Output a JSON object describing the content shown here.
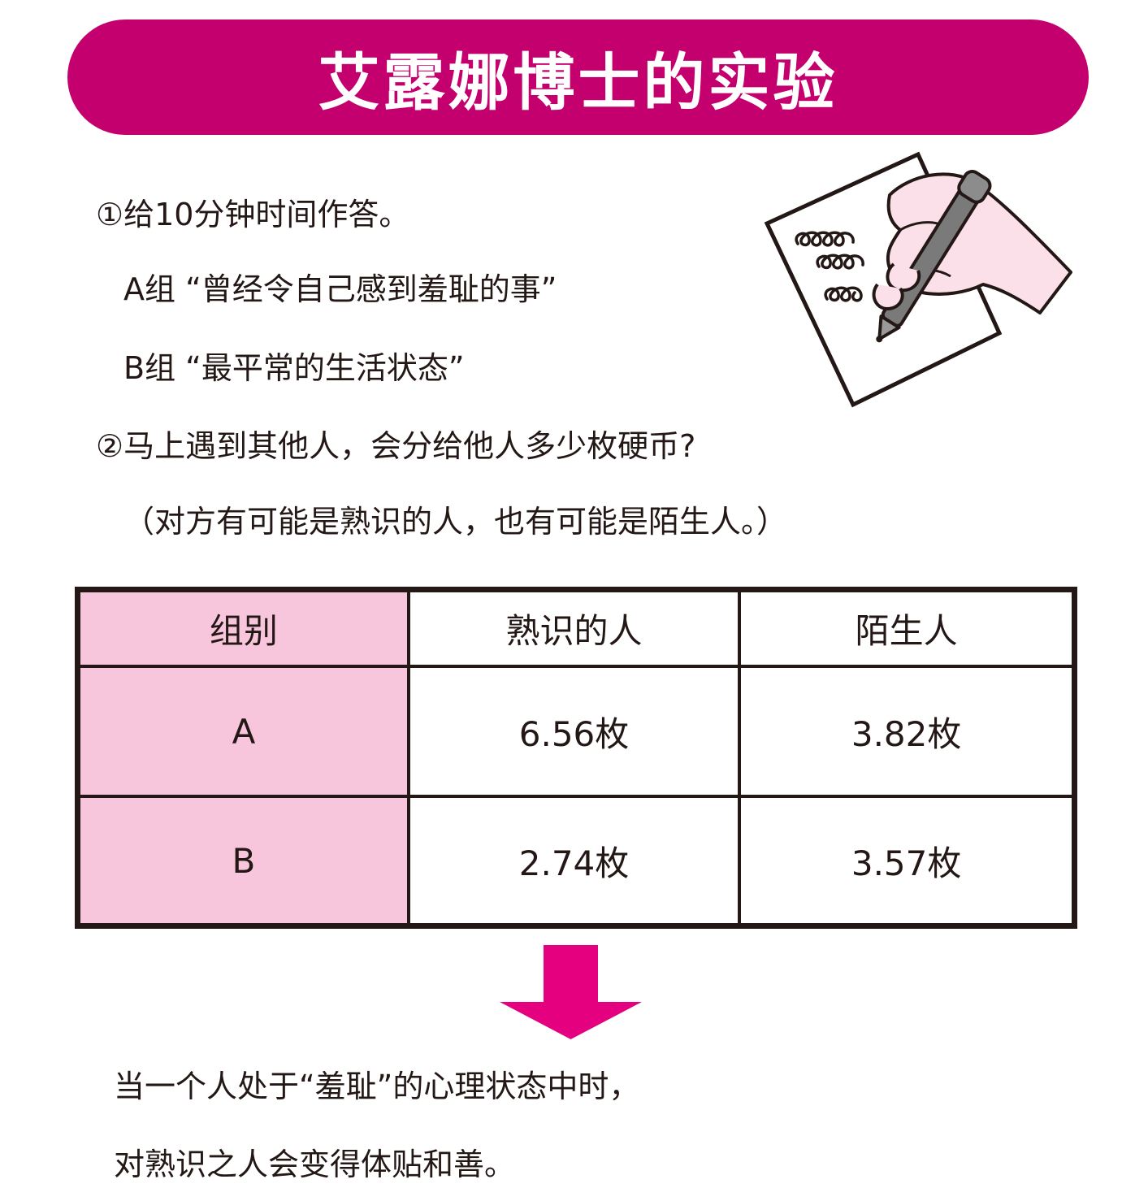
{
  "title": "艾露娜博士的实验",
  "steps": {
    "step1": "①给10分钟时间作答。",
    "group_a": "A组 “曾经令自己感到羞耻的事”",
    "group_b": "B组 “最平常的生活状态”",
    "step2": "②马上遇到其他人，会分给他人多少枚硬币?",
    "note": "（对方有可能是熟识的人，也有可能是陌生人。）"
  },
  "table": {
    "headers": [
      "组别",
      "熟识的人",
      "陌生人"
    ],
    "rows": [
      [
        "A",
        "6.56枚",
        "3.82枚"
      ],
      [
        "B",
        "2.74枚",
        "3.57枚"
      ]
    ]
  },
  "conclusion": {
    "line1": "当一个人处于“羞耻”的心理状态中时，",
    "line2": "对熟识之人会变得体贴和善。"
  },
  "colors": {
    "banner": "#c4006e",
    "table_header_fill": "#f8c6dc",
    "arrow": "#e4007f",
    "hand": "#fbe0e9"
  },
  "illustration": "hand-writing-with-pen-icon",
  "arrow_icon": "down-arrow-icon"
}
